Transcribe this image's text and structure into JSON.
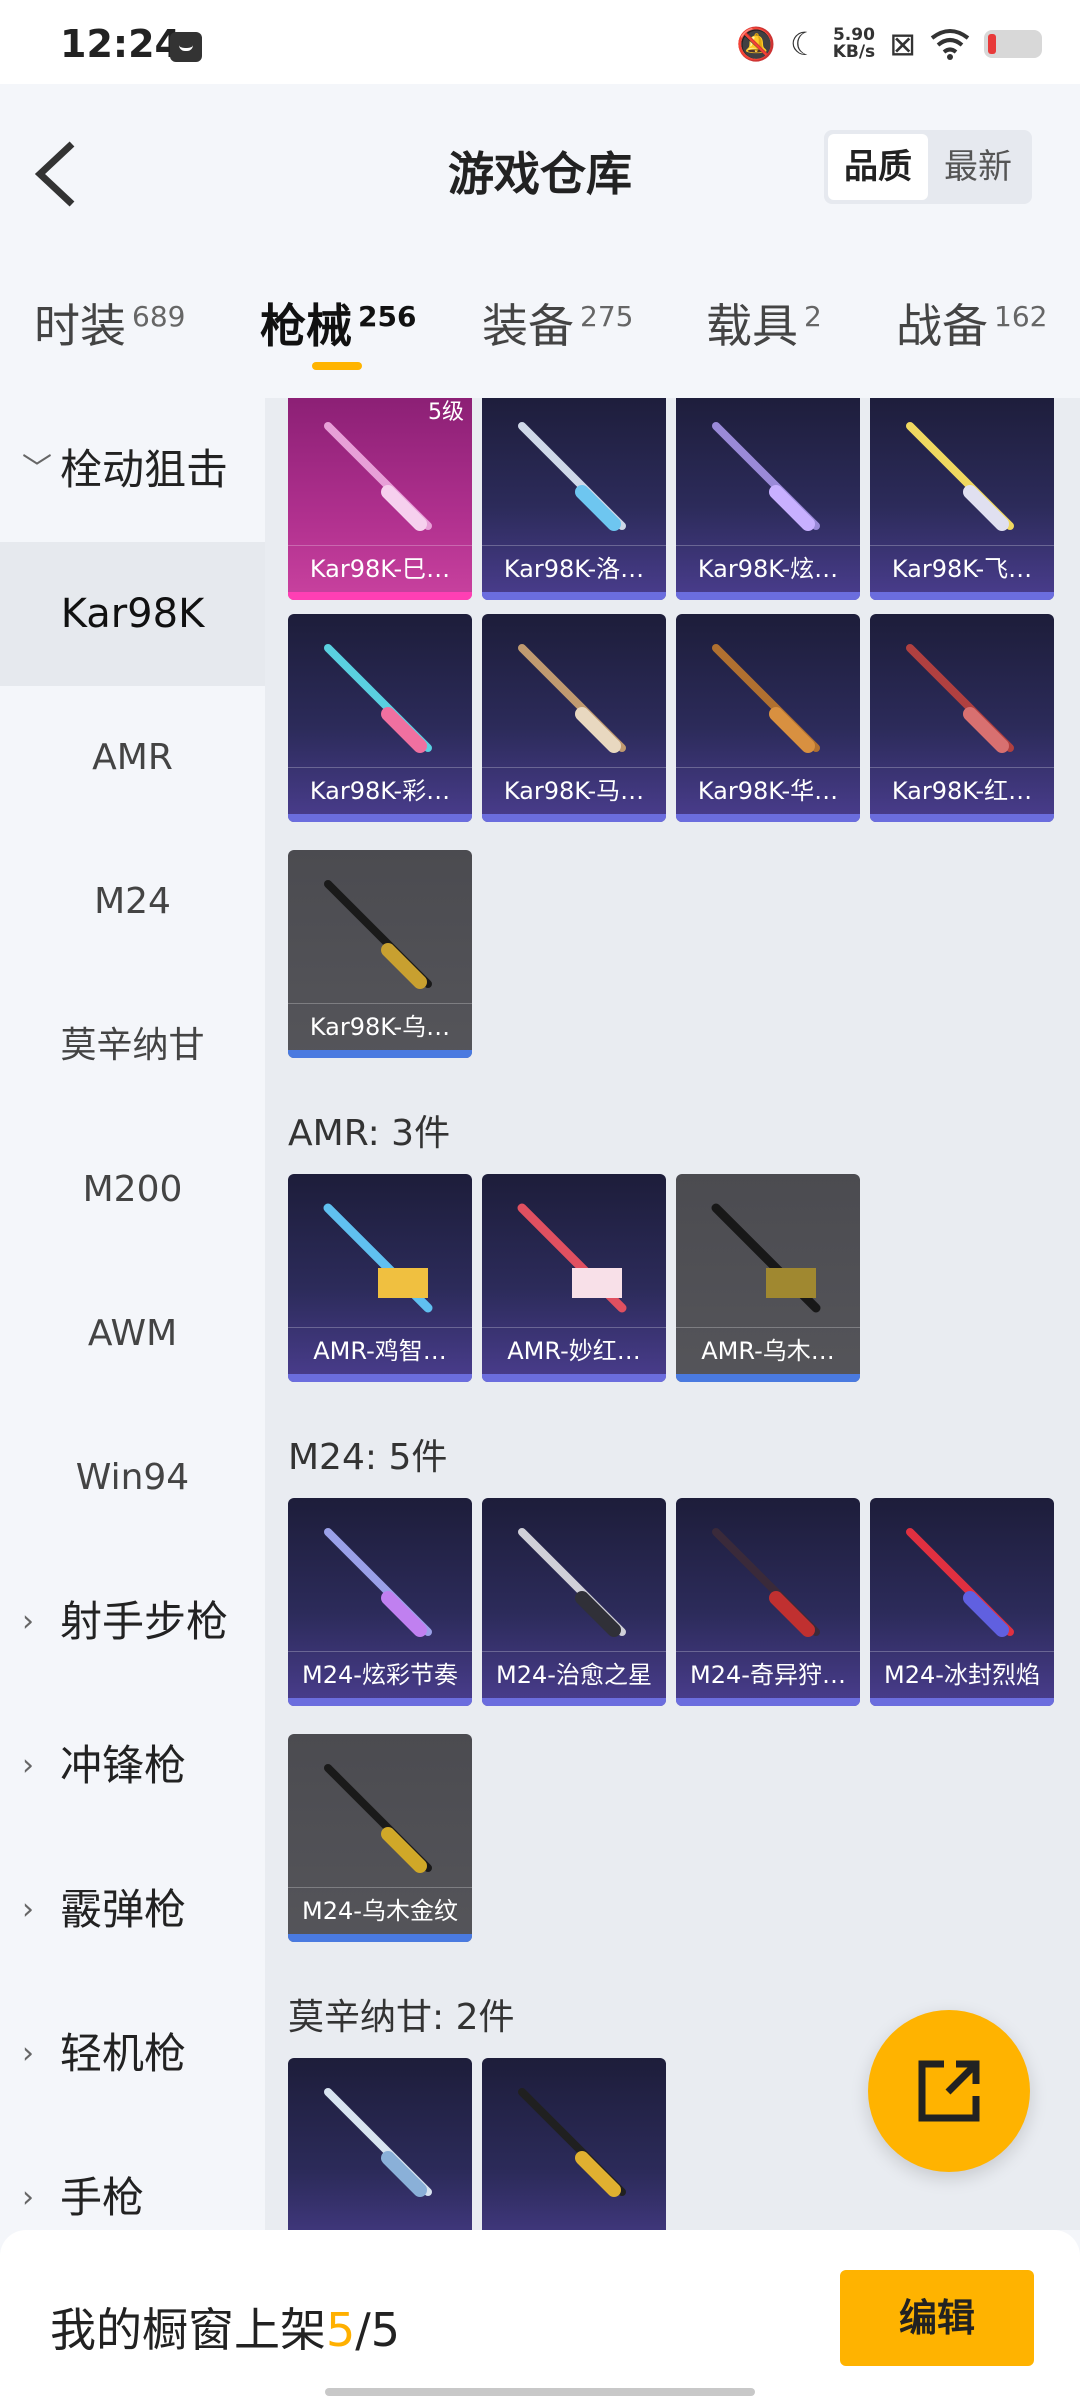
{
  "status_bar": {
    "time": "12:24",
    "net_speed_value": "5.90",
    "net_speed_unit": "KB/s"
  },
  "header": {
    "title": "游戏仓库",
    "sort_options": [
      "品质",
      "最新"
    ],
    "sort_selected": "品质"
  },
  "tabs": [
    {
      "label": "时装",
      "count": "689"
    },
    {
      "label": "枪械",
      "count": "256",
      "active": true
    },
    {
      "label": "装备",
      "count": "275"
    },
    {
      "label": "载具",
      "count": "2"
    },
    {
      "label": "战备",
      "count": "162"
    }
  ],
  "sidebar": {
    "group_expanded": "栓动狙击",
    "sub_items": [
      "Kar98K",
      "AMR",
      "M24",
      "莫辛纳甘",
      "M200",
      "AWM",
      "Win94"
    ],
    "selected": "Kar98K",
    "groups_collapsed": [
      "射手步枪",
      "冲锋枪",
      "霰弹枪",
      "轻机枪",
      "手枪"
    ]
  },
  "sections": {
    "kar98k": {
      "items": [
        "Kar98K-巳…",
        "Kar98K-洛…",
        "Kar98K-炫…",
        "Kar98K-飞…",
        "Kar98K-彩…",
        "Kar98K-马…",
        "Kar98K-华…",
        "Kar98K-红…",
        "Kar98K-乌…"
      ],
      "first_item_level": "5级"
    },
    "amr": {
      "title": "AMR: 3件",
      "items": [
        "AMR-鸡智…",
        "AMR-妙红…",
        "AMR-乌木…"
      ]
    },
    "m24": {
      "title": "M24: 5件",
      "items": [
        "M24-炫彩节奏",
        "M24-治愈之星",
        "M24-奇异狩…",
        "M24-冰封烈焰",
        "M24-乌木金纹"
      ]
    },
    "mosin": {
      "title": "莫辛纳甘: 2件"
    }
  },
  "bottom_bar": {
    "label": "我的橱窗上架",
    "current": "5",
    "separator": "/",
    "total": "5",
    "edit_label": "编辑"
  },
  "colors": {
    "accent": "#ffb300",
    "card_blue_bar": "#6b6dde",
    "card_pink_bar": "#ff3fb4",
    "card_grey_bar": "#4a7ae0"
  }
}
